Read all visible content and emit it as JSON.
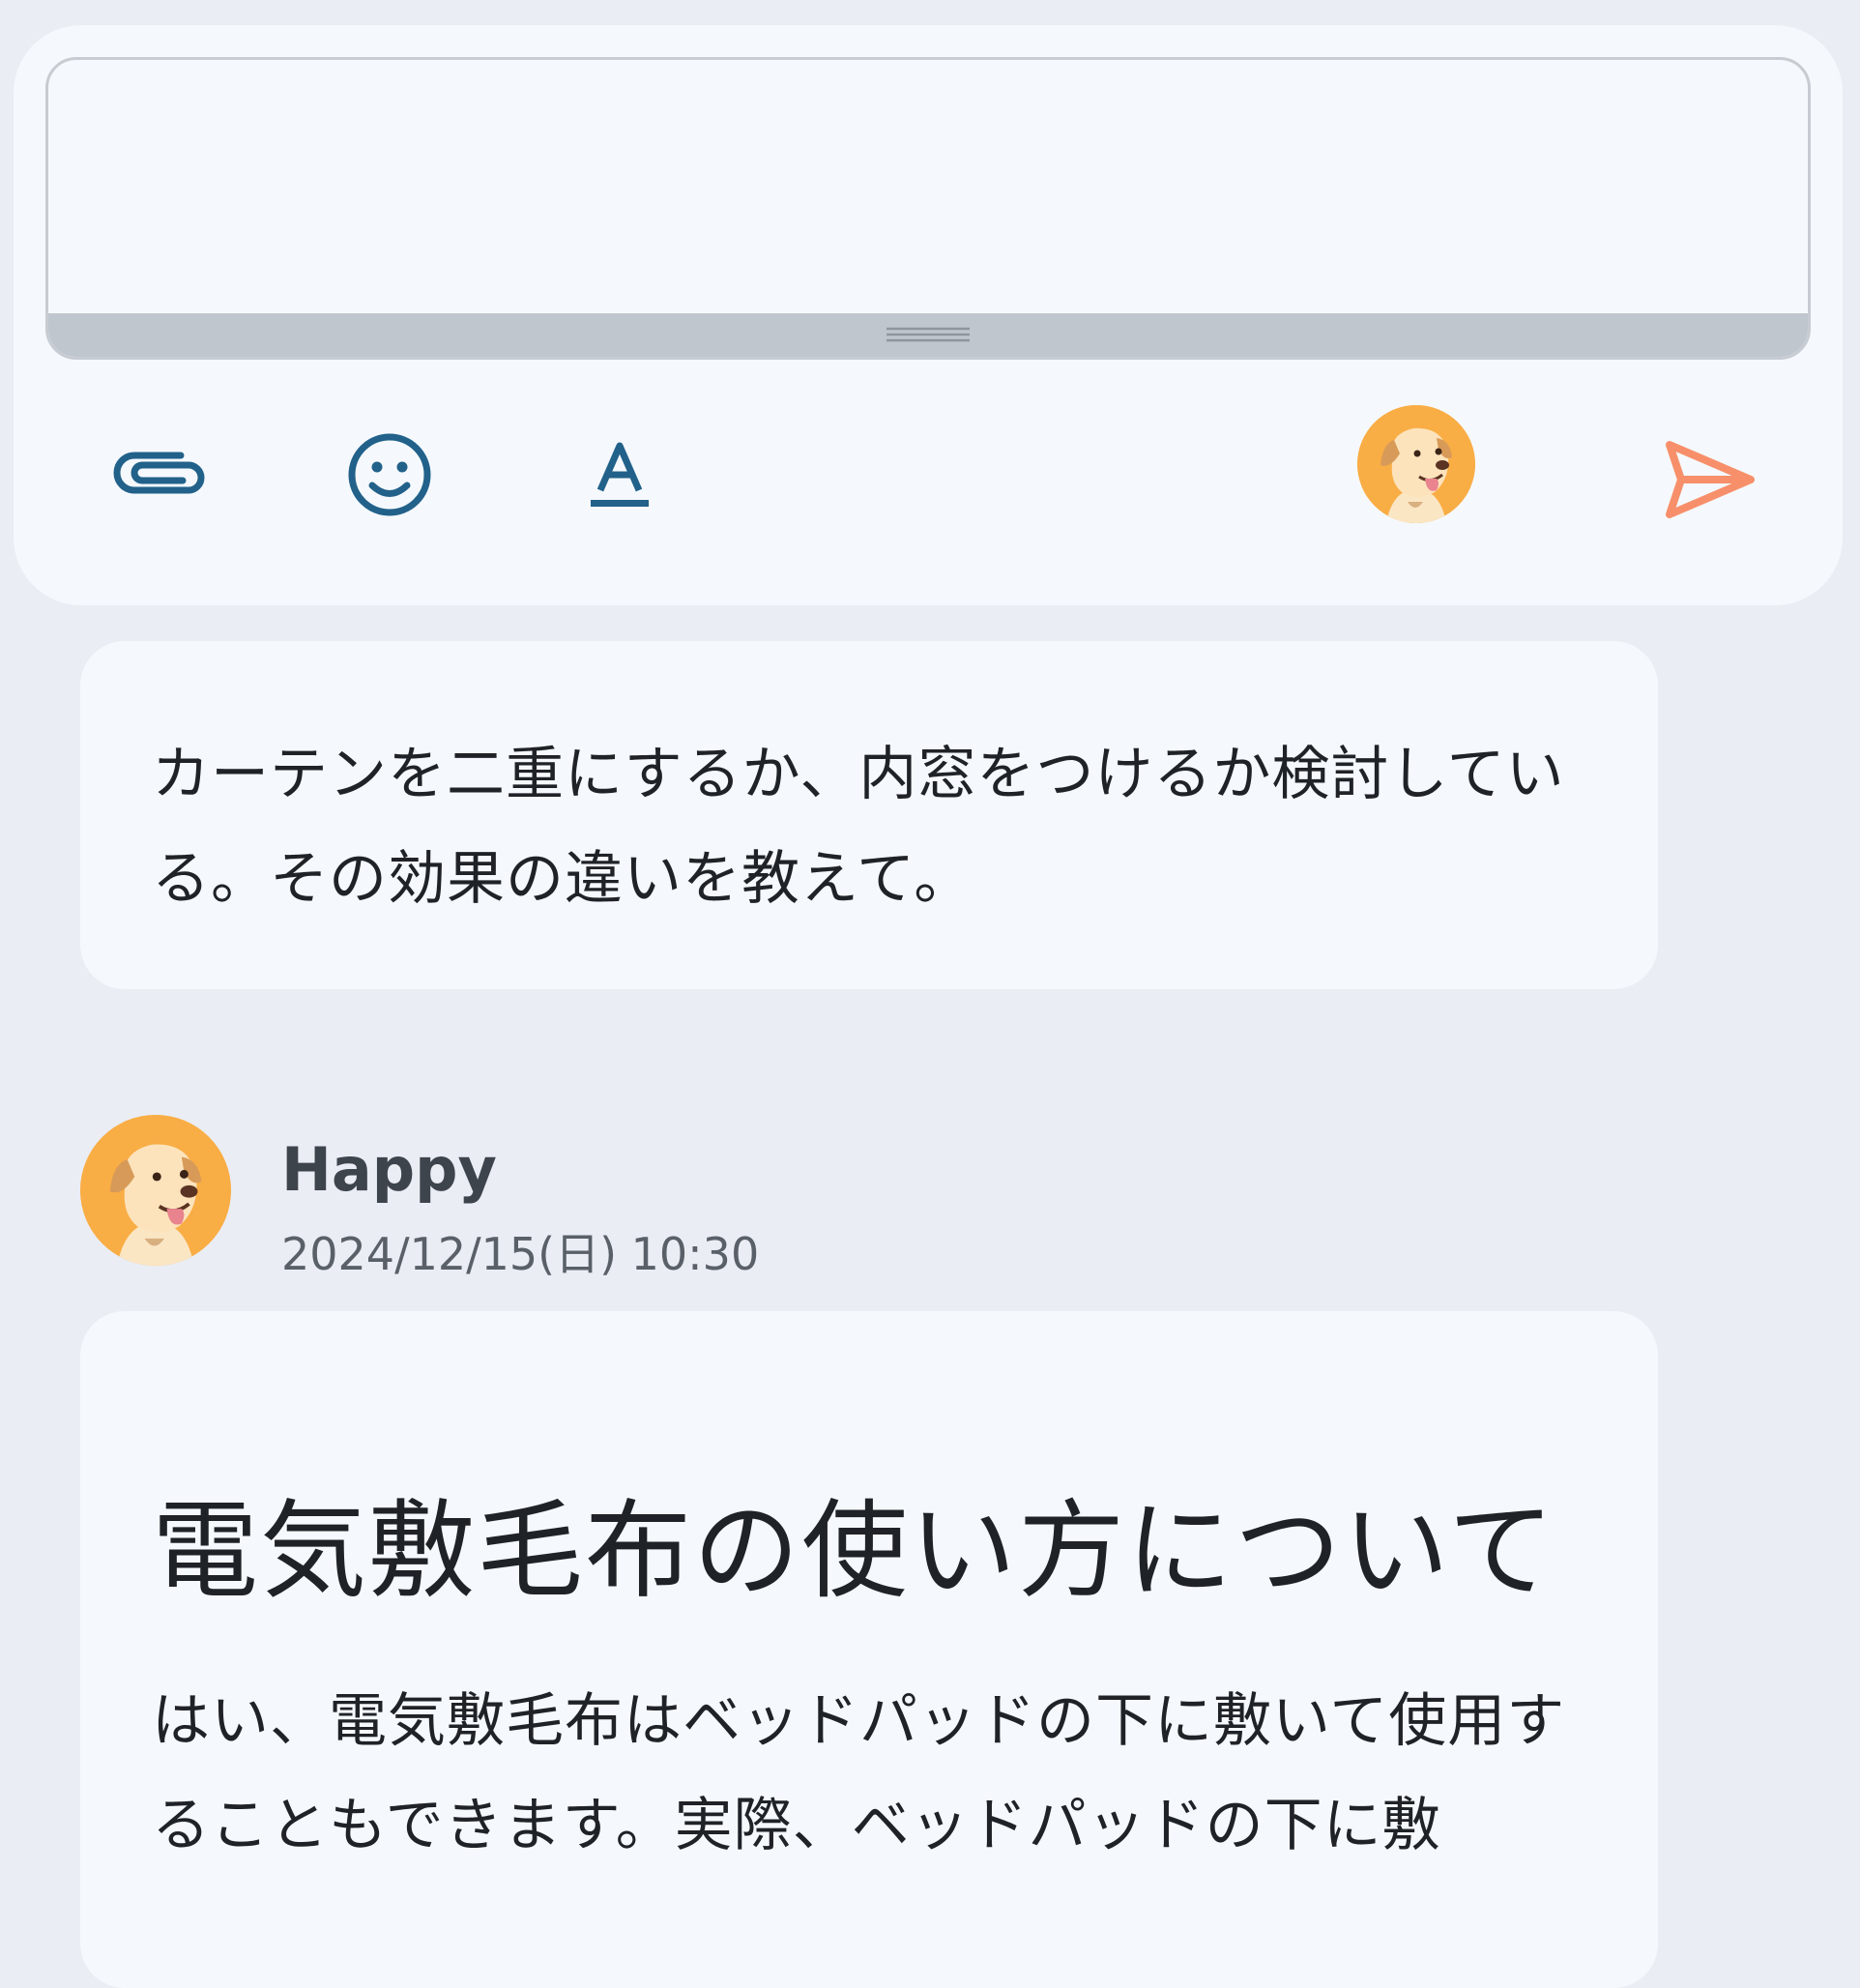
{
  "composer": {
    "input_placeholder": "",
    "icons": {
      "attach": "paperclip-icon",
      "emoji": "smiley-icon",
      "format": "text-format-icon",
      "avatar": "dog-avatar",
      "send": "send-icon"
    },
    "colors": {
      "icon": "#22618a",
      "send": "#f7906a",
      "avatar_bg": "#f9ad45"
    }
  },
  "messages": {
    "user_message": "カーテンを二重にするか、内窓をつけるか検討している。その効果の違いを教えて。",
    "reply": {
      "sender_name": "Happy",
      "timestamp": "2024/12/15(日) 10:30",
      "title": "電気敷毛布の使い方について",
      "body": "はい、電気敷毛布はベッドパッドの下に敷いて使用することもできます。実際、ベッドパッドの下に敷"
    }
  }
}
